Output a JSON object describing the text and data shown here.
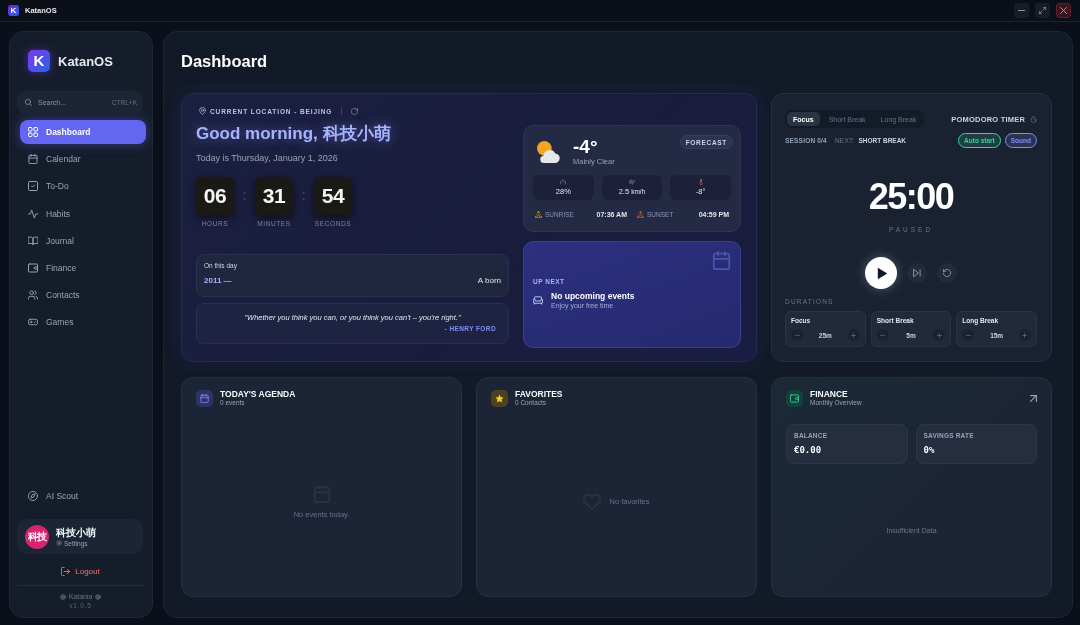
{
  "window": {
    "logo_mark": "K",
    "title": "KatanOS"
  },
  "sidebar": {
    "logo_mark": "K",
    "brand": "KatanOS",
    "search": {
      "placeholder": "Search...",
      "shortcut": "CTRL+K"
    },
    "items": [
      {
        "label": "Dashboard",
        "selected": true
      },
      {
        "label": "Calendar",
        "selected": false
      },
      {
        "label": "To-Do",
        "selected": false
      },
      {
        "label": "Habits",
        "selected": false
      },
      {
        "label": "Journal",
        "selected": false
      },
      {
        "label": "Finance",
        "selected": false
      },
      {
        "label": "Contacts",
        "selected": false
      },
      {
        "label": "Games",
        "selected": false
      }
    ],
    "bottom_items": [
      {
        "label": "AI Scout",
        "selected": false
      }
    ],
    "user": {
      "avatar": "科技",
      "name": "科技小萌",
      "settings": "Settings"
    },
    "logout": "Logout",
    "credit": "Katania",
    "version": "v1.0.5"
  },
  "page_title": "Dashboard",
  "hero": {
    "location": "CURRENT LOCATION - BEIJING",
    "greeting": "Good morning, 科技小萌",
    "date": "Today is Thursday, January 1, 2026",
    "clock": [
      {
        "value": "06",
        "label": "HOURS"
      },
      {
        "value": "31",
        "label": "MINUTES"
      },
      {
        "value": "54",
        "label": "SECONDS"
      }
    ],
    "on_this_day": {
      "heading": "On this day",
      "year": "2011 —",
      "text": "A born"
    },
    "quote": {
      "text": "\"Whether you think you can, or you think you can't – you're right.\"",
      "author": "- HENRY FORD"
    }
  },
  "weather": {
    "temperature": "-4°",
    "condition": "Mainly Clear",
    "forecast": "FORECAST",
    "stats": [
      {
        "value": "28%"
      },
      {
        "value": "2.5",
        "unit": "km/h"
      },
      {
        "value": "-8°"
      }
    ],
    "sun": [
      {
        "label": "SUNRISE",
        "time": "07:36 AM"
      },
      {
        "label": "SUNSET",
        "time": "04:59 PM"
      }
    ]
  },
  "up_next": {
    "label": "UP NEXT",
    "title": "No upcoming events",
    "subtitle": "Enjoy your free time"
  },
  "pomodoro": {
    "tabs": [
      {
        "label": "Focus",
        "selected": true
      },
      {
        "label": "Short Break",
        "selected": false
      },
      {
        "label": "Long Break",
        "selected": false
      }
    ],
    "title": "POMODORO TIMER",
    "session": "SESSION 0/4",
    "next_label": "NEXT:",
    "next_value": "SHORT BREAK",
    "toggles": [
      {
        "label": "Auto start",
        "on": true,
        "color": "#34d399"
      },
      {
        "label": "Sound",
        "on": true,
        "color": "#818cf8"
      }
    ],
    "time": "25:00",
    "status": "PAUSED",
    "durations_label": "DURATIONS",
    "durations": [
      {
        "label": "Focus",
        "value": "25m"
      },
      {
        "label": "Short Break",
        "value": "5m"
      },
      {
        "label": "Long Break",
        "value": "15m"
      }
    ]
  },
  "agenda": {
    "title": "TODAY'S AGENDA",
    "count": "0 events",
    "empty": "No events today."
  },
  "favorites": {
    "title": "FAVORITES",
    "count": "0 Contacts",
    "empty": "No favorites"
  },
  "finance": {
    "title": "FINANCE",
    "subtitle": "Monthly Overview",
    "stats": [
      {
        "label": "BALANCE",
        "value": "€0.00"
      },
      {
        "label": "SAVINGS RATE",
        "value": "0%"
      }
    ],
    "empty": "Insufficient Data"
  }
}
